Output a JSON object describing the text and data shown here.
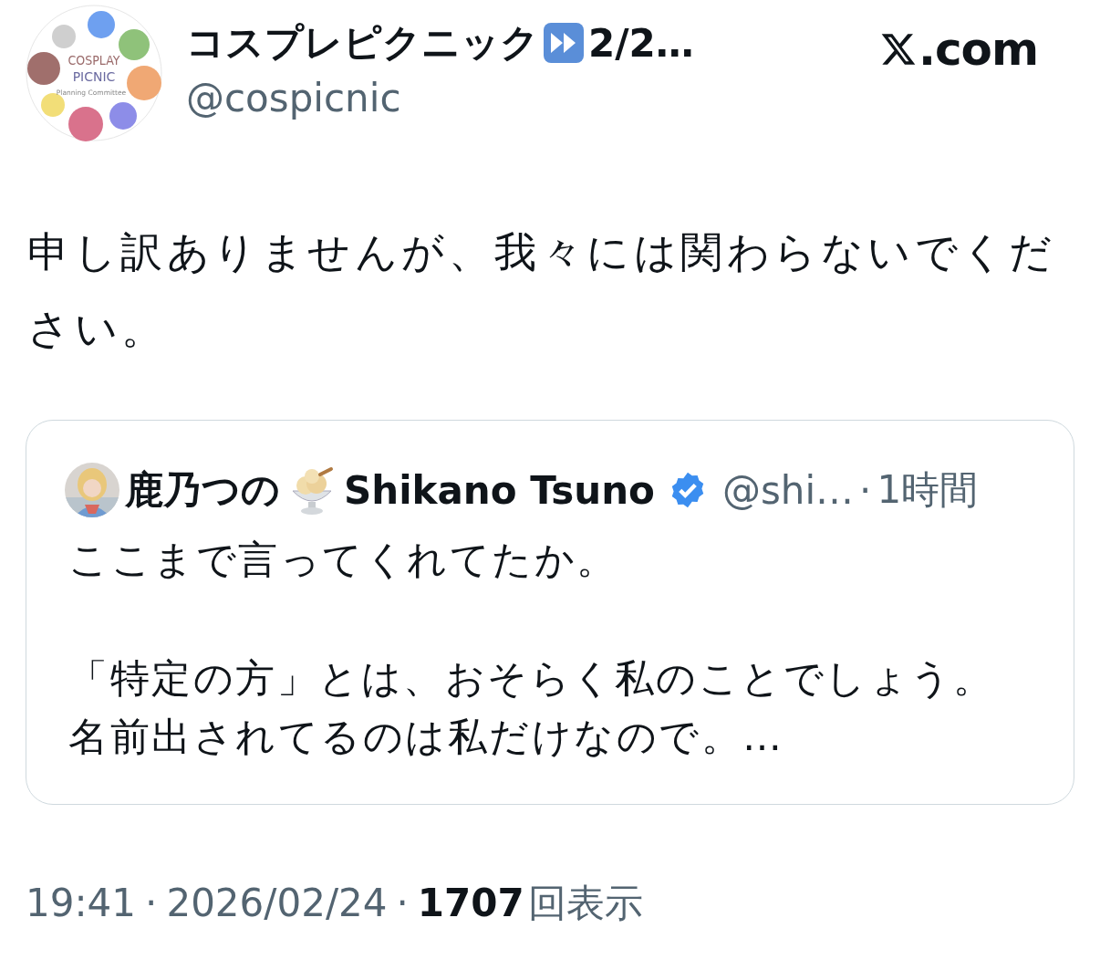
{
  "author": {
    "avatar_logo": [
      "COSPLAY",
      "PICNIC",
      "Planning Committee"
    ],
    "name": "コスプレピクニック",
    "name_suffix": "2/2…",
    "handle": "@cospicnic"
  },
  "site": ".com",
  "body": "申し訳ありませんが、我々には関わらないでください。",
  "quote": {
    "name": "鹿乃つの",
    "name_latin": "Shikano Tsuno",
    "verified": true,
    "handle": "@shi…",
    "separator": "·",
    "time": "1時間",
    "paragraphs": [
      {
        "lines": [
          "ここまで言ってくれてたか。"
        ]
      },
      {
        "lines": [
          "「特定の方」とは、おそらく私のことでしょう。",
          "名前出されてるのは私だけなので。…"
        ]
      }
    ]
  },
  "meta": {
    "time": "19:41",
    "separator": "·",
    "date": "2026/02/24",
    "views": "1707",
    "views_label": "回表示"
  }
}
